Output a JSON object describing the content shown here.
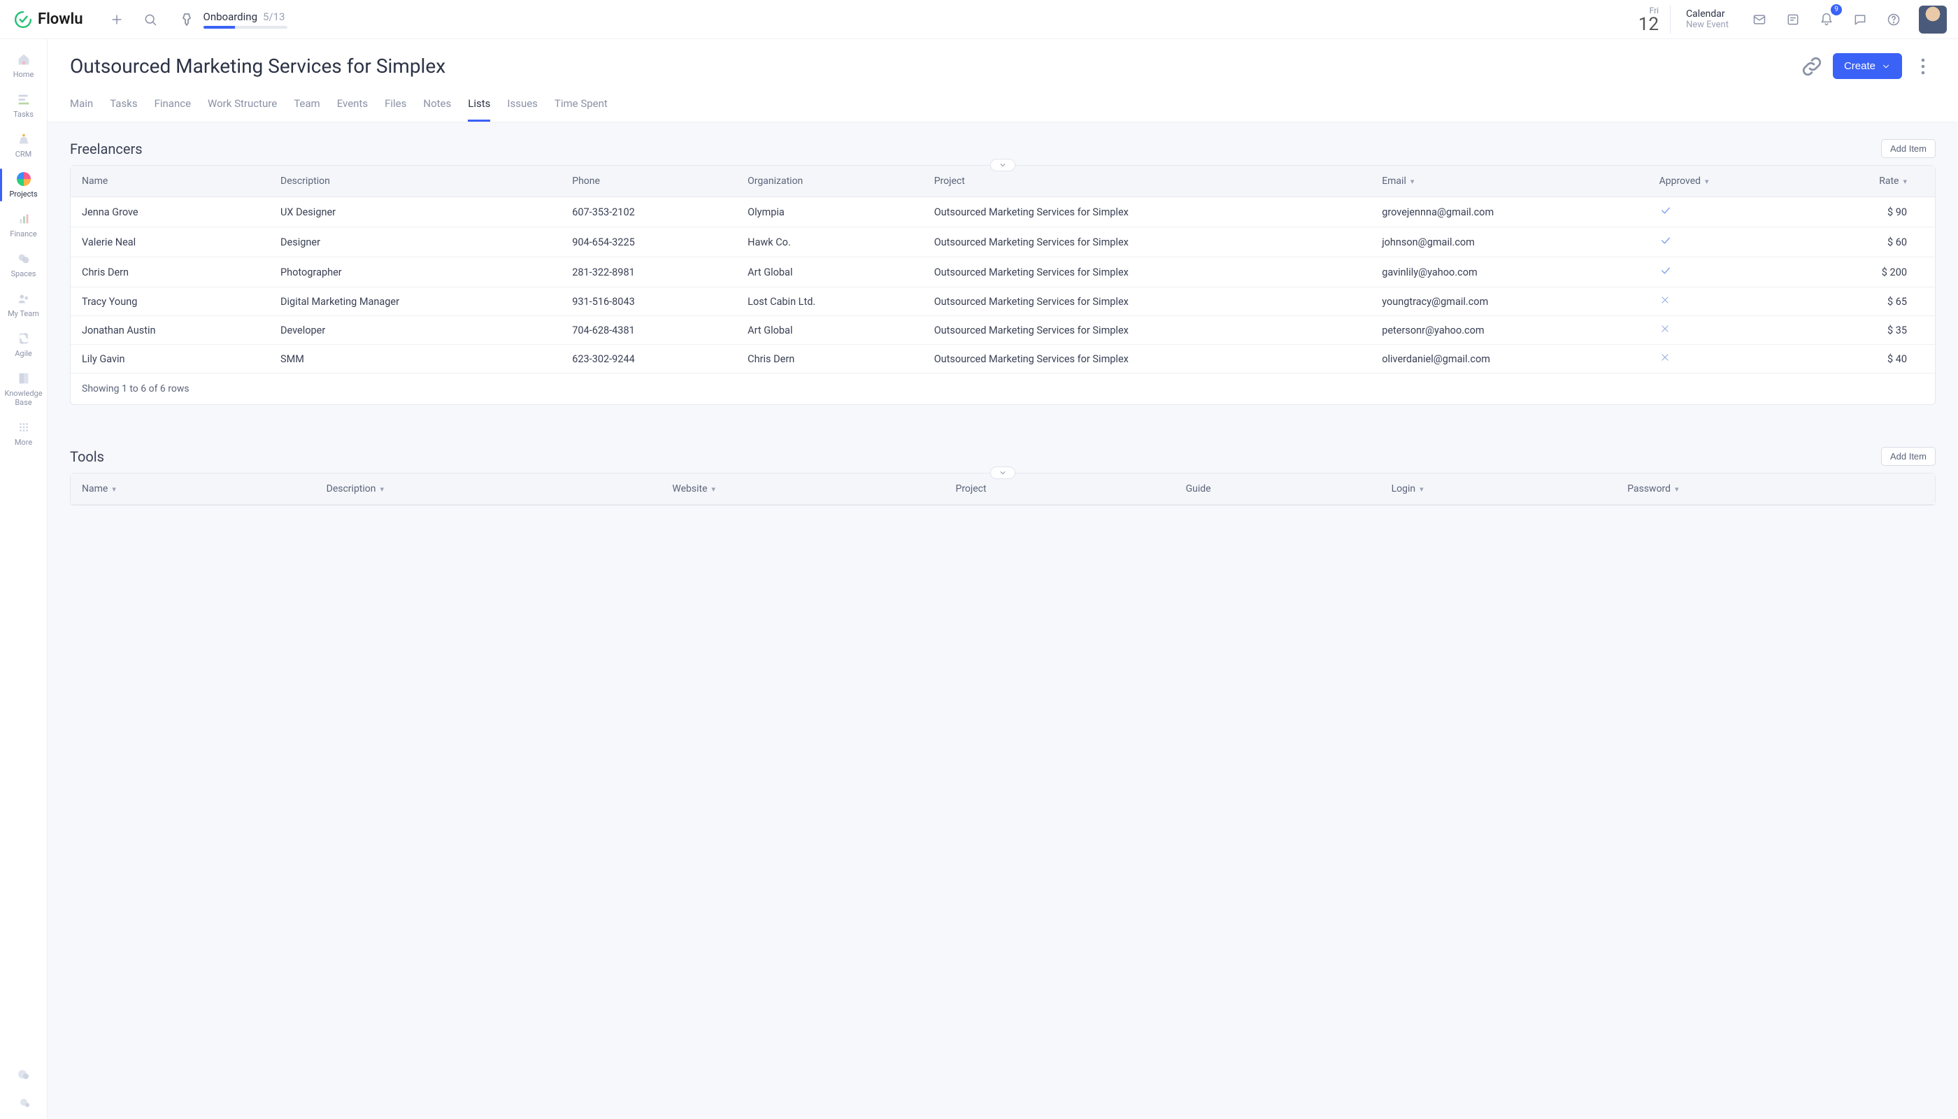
{
  "brand": "Flowlu",
  "topbar": {
    "onboarding_label": "Onboarding",
    "onboarding_count": "5/13",
    "date_dow": "Fri",
    "date_num": "12",
    "calendar_label": "Calendar",
    "calendar_sub": "New Event",
    "notif_count": "9"
  },
  "sidebar": {
    "items": [
      {
        "label": "Home"
      },
      {
        "label": "Tasks"
      },
      {
        "label": "CRM"
      },
      {
        "label": "Projects"
      },
      {
        "label": "Finance"
      },
      {
        "label": "Spaces"
      },
      {
        "label": "My Team"
      },
      {
        "label": "Agile"
      },
      {
        "label": "Knowledge Base"
      },
      {
        "label": "More"
      }
    ]
  },
  "page": {
    "title": "Outsourced Marketing Services for Simplex",
    "create_label": "Create",
    "tabs": [
      "Main",
      "Tasks",
      "Finance",
      "Work Structure",
      "Team",
      "Events",
      "Files",
      "Notes",
      "Lists",
      "Issues",
      "Time Spent"
    ],
    "active_tab": "Lists"
  },
  "lists": [
    {
      "title": "Freelancers",
      "add_label": "Add Item",
      "columns": [
        {
          "label": "Name",
          "sort": false
        },
        {
          "label": "Description",
          "sort": false
        },
        {
          "label": "Phone",
          "sort": false
        },
        {
          "label": "Organization",
          "sort": false
        },
        {
          "label": "Project",
          "sort": false
        },
        {
          "label": "Email",
          "sort": true
        },
        {
          "label": "Approved",
          "sort": true
        },
        {
          "label": "Rate",
          "sort": true
        }
      ],
      "rows": [
        {
          "name": "Jenna Grove",
          "desc": "UX Designer",
          "phone": "607-353-2102",
          "org": "Olympia",
          "project": "Outsourced Marketing Services for Simplex",
          "email": "grovejennna@gmail.com",
          "approved": true,
          "rate": "$ 90"
        },
        {
          "name": "Valerie Neal",
          "desc": "Designer",
          "phone": "904-654-3225",
          "org": "Hawk Co.",
          "project": "Outsourced Marketing Services for Simplex",
          "email": "johnson@gmail.com",
          "approved": true,
          "rate": "$ 60"
        },
        {
          "name": "Chris Dern",
          "desc": "Photographer",
          "phone": "281-322-8981",
          "org": "Art Global",
          "project": "Outsourced Marketing Services for Simplex",
          "email": "gavinlily@yahoo.com",
          "approved": true,
          "rate": "$ 200"
        },
        {
          "name": "Tracy Young",
          "desc": "Digital Marketing Manager",
          "phone": "931-516-8043",
          "org": "Lost Cabin Ltd.",
          "project": "Outsourced Marketing Services for Simplex",
          "email": "youngtracy@gmail.com",
          "approved": false,
          "rate": "$ 65"
        },
        {
          "name": "Jonathan Austin",
          "desc": "Developer",
          "phone": "704-628-4381",
          "org": "Art Global",
          "project": "Outsourced Marketing Services for Simplex",
          "email": "petersonr@yahoo.com",
          "approved": false,
          "rate": "$ 35"
        },
        {
          "name": "Lily Gavin",
          "desc": "SMM",
          "phone": "623-302-9244",
          "org": "Chris Dern",
          "project": "Outsourced Marketing Services for Simplex",
          "email": "oliverdaniel@gmail.com",
          "approved": false,
          "rate": "$ 40"
        }
      ],
      "footer": "Showing 1 to 6 of 6 rows"
    },
    {
      "title": "Tools",
      "add_label": "Add Item",
      "columns": [
        {
          "label": "Name",
          "sort": true
        },
        {
          "label": "Description",
          "sort": true
        },
        {
          "label": "Website",
          "sort": true
        },
        {
          "label": "Project",
          "sort": false
        },
        {
          "label": "Guide",
          "sort": false
        },
        {
          "label": "Login",
          "sort": true
        },
        {
          "label": "Password",
          "sort": true
        }
      ]
    }
  ]
}
